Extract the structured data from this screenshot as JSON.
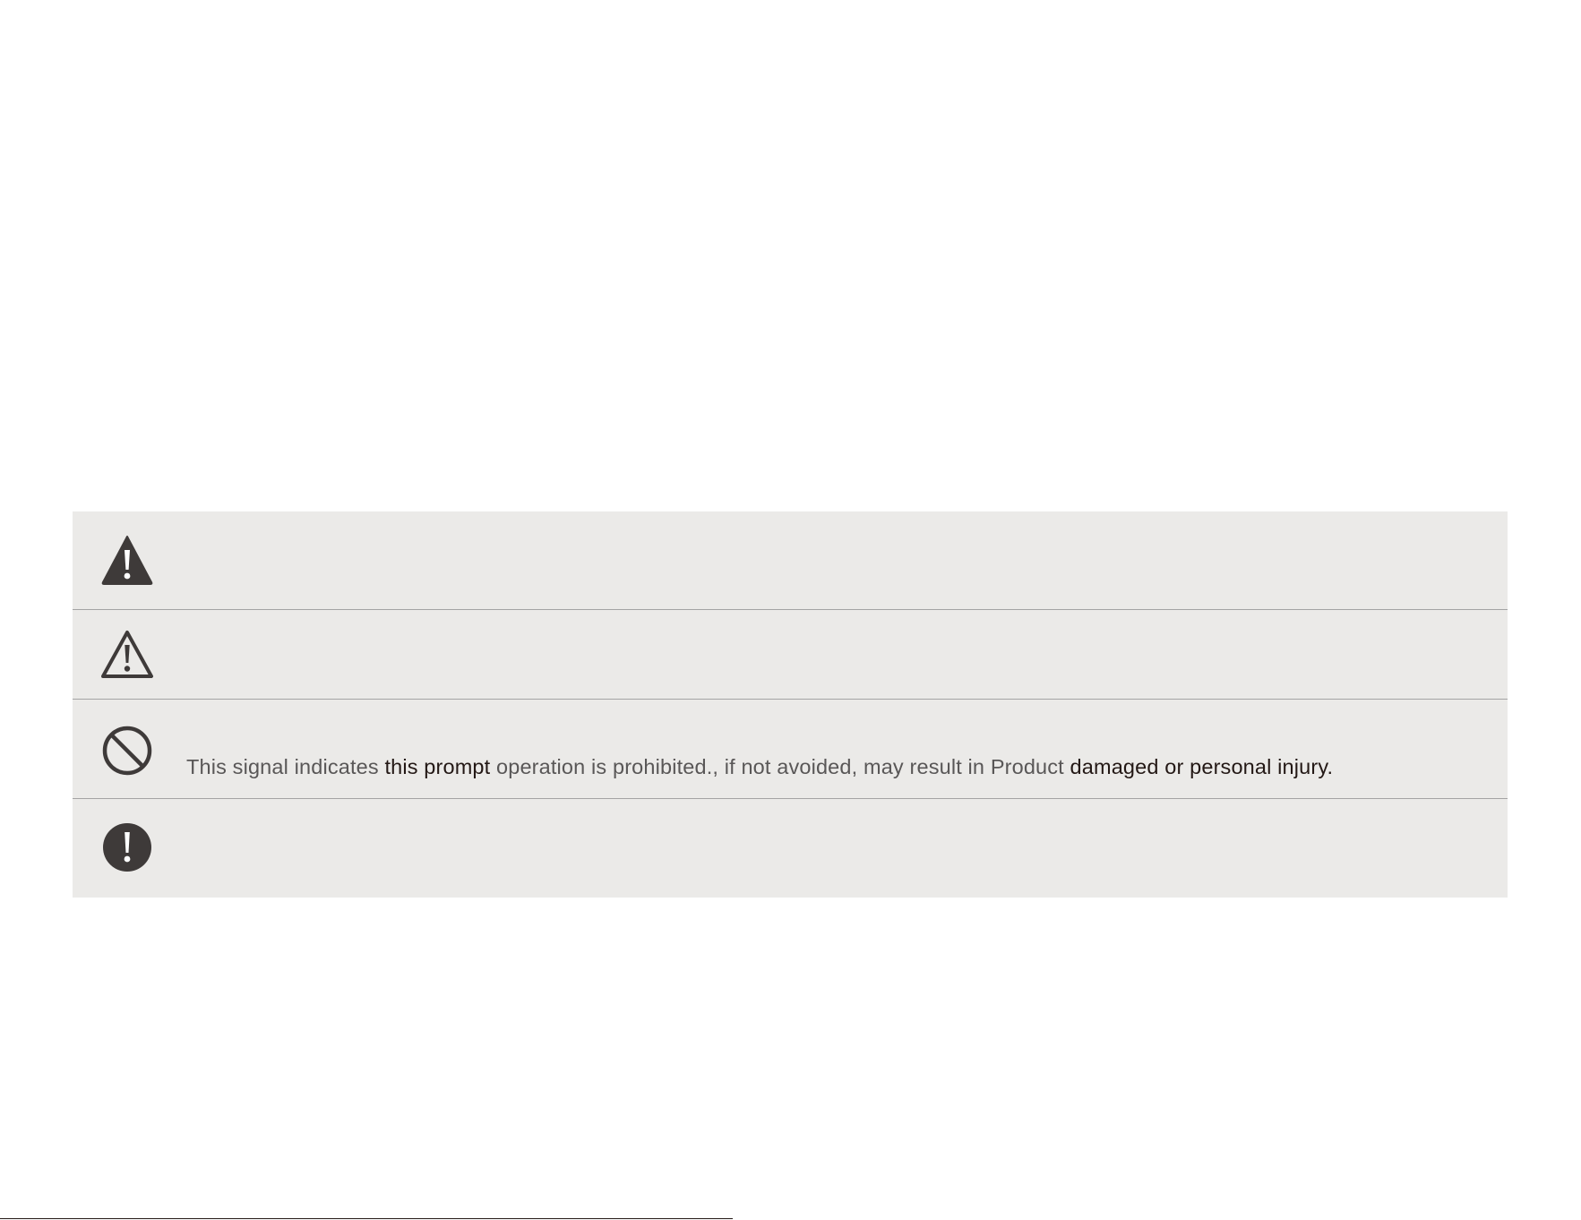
{
  "signals": [
    {
      "icon": "filled-warning-triangle-icon",
      "text": ""
    },
    {
      "icon": "outline-warning-triangle-icon",
      "text": ""
    },
    {
      "icon": "prohibition-icon",
      "text_parts": [
        "This signal indicates ",
        "this prompt",
        " operation is prohibited., if not avoided, may result in Product ",
        "damaged or personal injury."
      ]
    },
    {
      "icon": "mandatory-exclamation-icon",
      "text": ""
    }
  ],
  "colors": {
    "panel_background": "#ebeae8",
    "divider": "#a4a4a4",
    "icon": "#3e3a39",
    "text_gray": "#595757",
    "text_dark": "#231815"
  }
}
